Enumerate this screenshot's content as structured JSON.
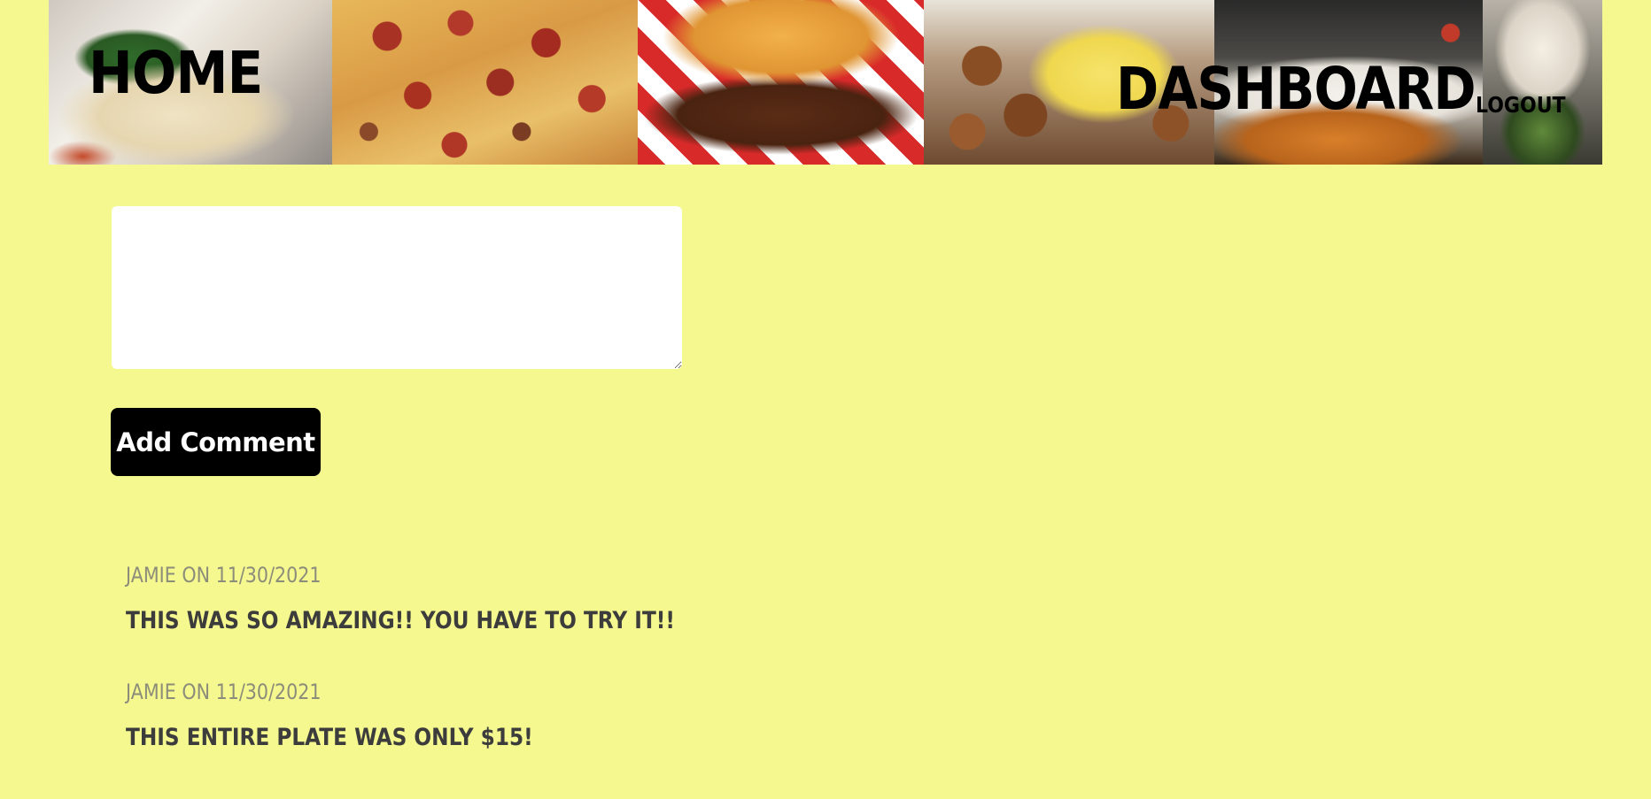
{
  "nav": {
    "home_label": "HOME",
    "dashboard_label": "DASHBOARD",
    "logout_label": "LOGOUT"
  },
  "comment_form": {
    "input_value": "",
    "submit_label": "Add Comment"
  },
  "comments": [
    {
      "meta": "JAMIE ON 11/30/2021",
      "text": "THIS WAS SO AMAZING!! YOU HAVE TO TRY IT!!"
    },
    {
      "meta": "JAMIE ON 11/30/2021",
      "text": "THIS ENTIRE PLATE WAS ONLY $15!"
    }
  ],
  "colors": {
    "background": "#f5f78f",
    "button": "#000000",
    "meta_text": "#8c8c7a",
    "comment_text": "#3c3c3c"
  }
}
